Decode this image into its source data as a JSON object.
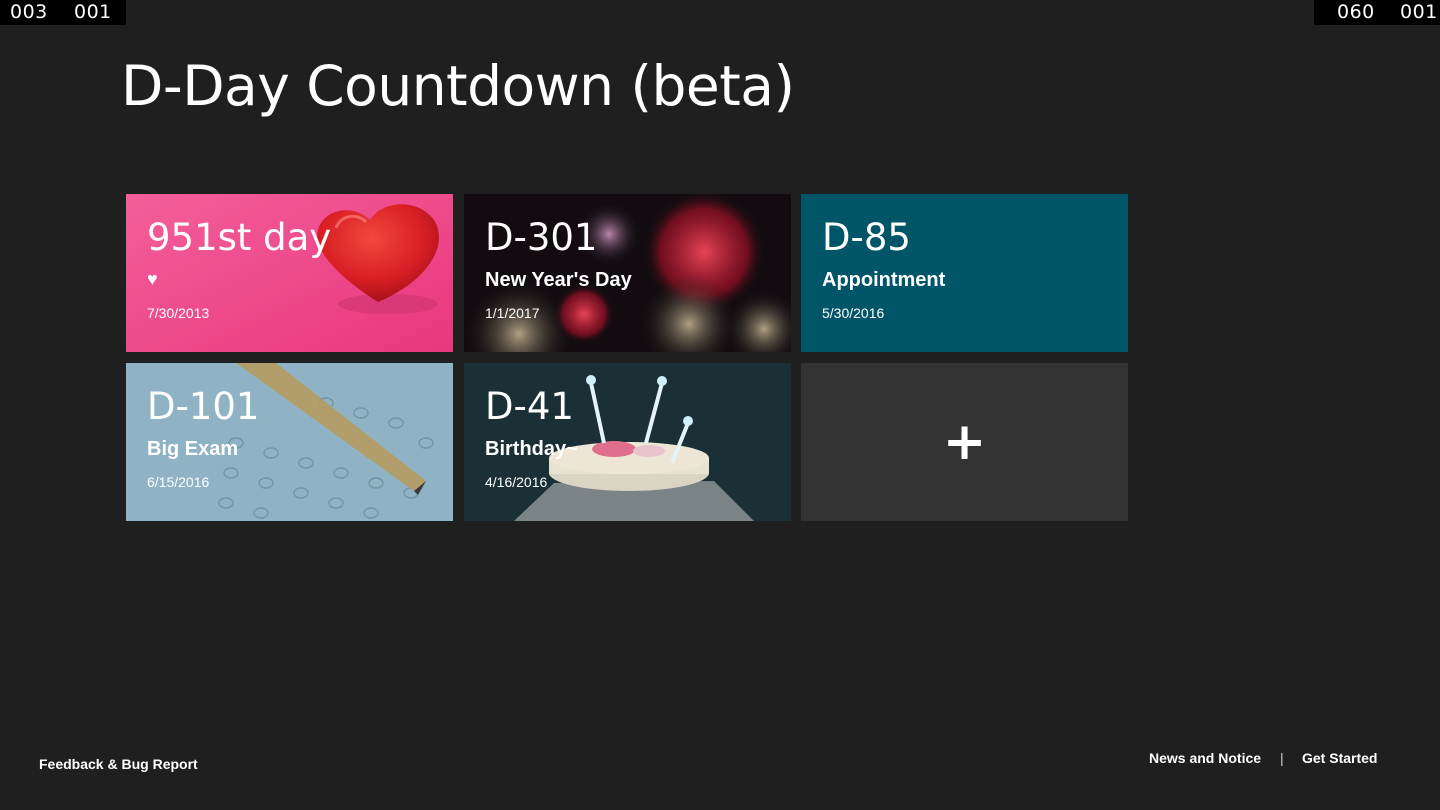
{
  "counters": {
    "left": [
      "003",
      "001"
    ],
    "right": [
      "060",
      "001"
    ]
  },
  "app": {
    "title": "D-Day Countdown (beta)"
  },
  "tiles": [
    {
      "count": "951st day",
      "subtitle": "♥",
      "date": "7/30/2013",
      "background": "#f04f8e",
      "image": "red-glitter-heart"
    },
    {
      "count": "D-301",
      "subtitle": "New Year's Day",
      "date": "1/1/2017",
      "background": "#120c10",
      "image": "fireworks"
    },
    {
      "count": "D-85",
      "subtitle": "Appointment",
      "date": "5/30/2016",
      "background": "#005569"
    },
    {
      "count": "D-101",
      "subtitle": "Big Exam",
      "date": "6/15/2016",
      "background": "#8fb3c4",
      "image": "pencil-on-answer-sheet"
    },
    {
      "count": "D-41",
      "subtitle": "Birthday~",
      "date": "4/16/2016",
      "background": "#1b3036",
      "image": "birthday-cake-candles"
    }
  ],
  "add_tile": {
    "icon": "plus-icon",
    "glyph": "+",
    "background": "#323232"
  },
  "footer": {
    "feedback": "Feedback & Bug Report",
    "news": "News and Notice",
    "separator": "|",
    "get_started": "Get Started"
  },
  "colors": {
    "page_background": "#1f1f1f",
    "text": "#ffffff"
  }
}
